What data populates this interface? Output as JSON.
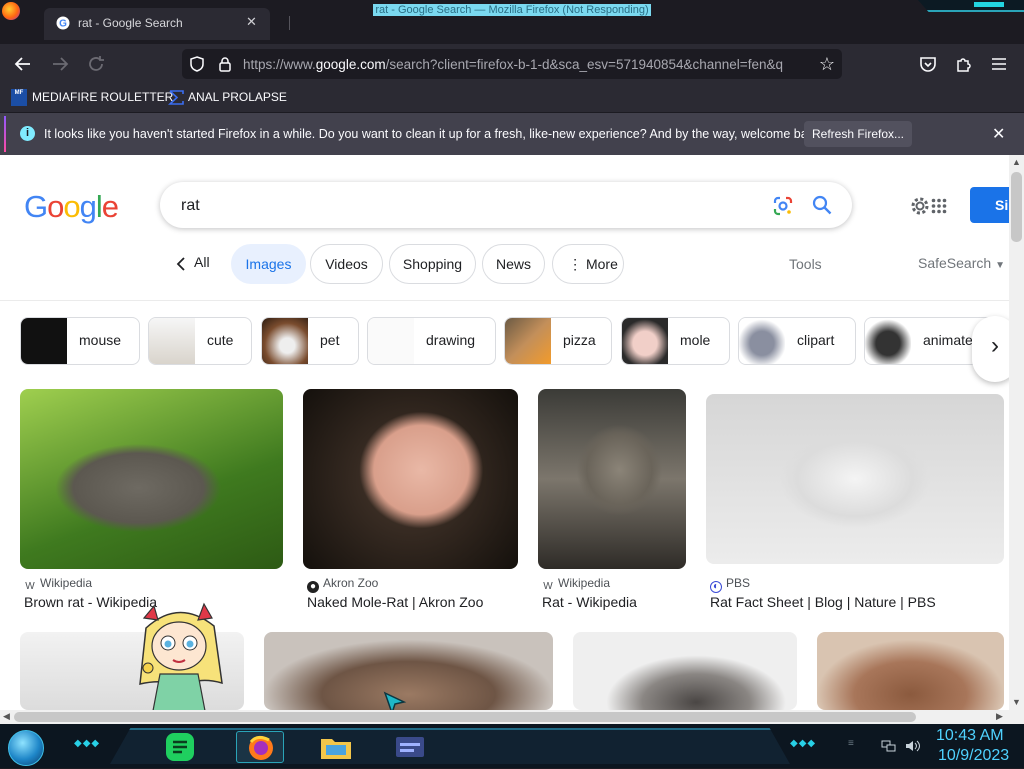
{
  "window": {
    "title": "rat - Google Search — Mozilla Firefox (Not Responding)",
    "tab_title": "rat - Google Search",
    "tab_close": "✕"
  },
  "nav": {
    "url_prefix": "https://www.",
    "url_domain": "google.com",
    "url_rest": "/search?client=firefox-b-1-d&sca_esv=571940854&channel=fen&q"
  },
  "bookmarks": [
    {
      "label": "MEDIAFIRE ROULETTER",
      "icon_text": "MF"
    },
    {
      "label": "ANAL PROLAPSE"
    }
  ],
  "notification": {
    "text": "It looks like you haven't started Firefox in a while. Do you want to clean it up for a fresh, like-new experience? And by the way, welcome back!",
    "button": "Refresh Firefox...",
    "close": "✕"
  },
  "search": {
    "query": "rat",
    "signin": "Si"
  },
  "tabs": {
    "all": "All",
    "items": [
      "Images",
      "Videos",
      "Shopping",
      "News",
      "More"
    ],
    "tools": "Tools",
    "safesearch": "SafeSearch"
  },
  "related": [
    "mouse",
    "cute",
    "pet",
    "drawing",
    "pizza",
    "mole",
    "clipart",
    "animate"
  ],
  "results": [
    {
      "source": "Wikipedia",
      "caption": "Brown rat - Wikipedia"
    },
    {
      "source": "Akron Zoo",
      "caption": "Naked Mole-Rat | Akron Zoo"
    },
    {
      "source": "Wikipedia",
      "caption": "Rat - Wikipedia"
    },
    {
      "source": "PBS",
      "caption": "Rat Fact Sheet | Blog | Nature | PBS"
    }
  ],
  "clock": {
    "time": "10:43 AM",
    "date": "10/9/2023"
  },
  "colors": {
    "firefox_dark": "#1c1b22",
    "firefox_toolbar": "#2b2a33",
    "google_blue": "#1a73e8",
    "taskbar_accent": "#28d0e6"
  }
}
